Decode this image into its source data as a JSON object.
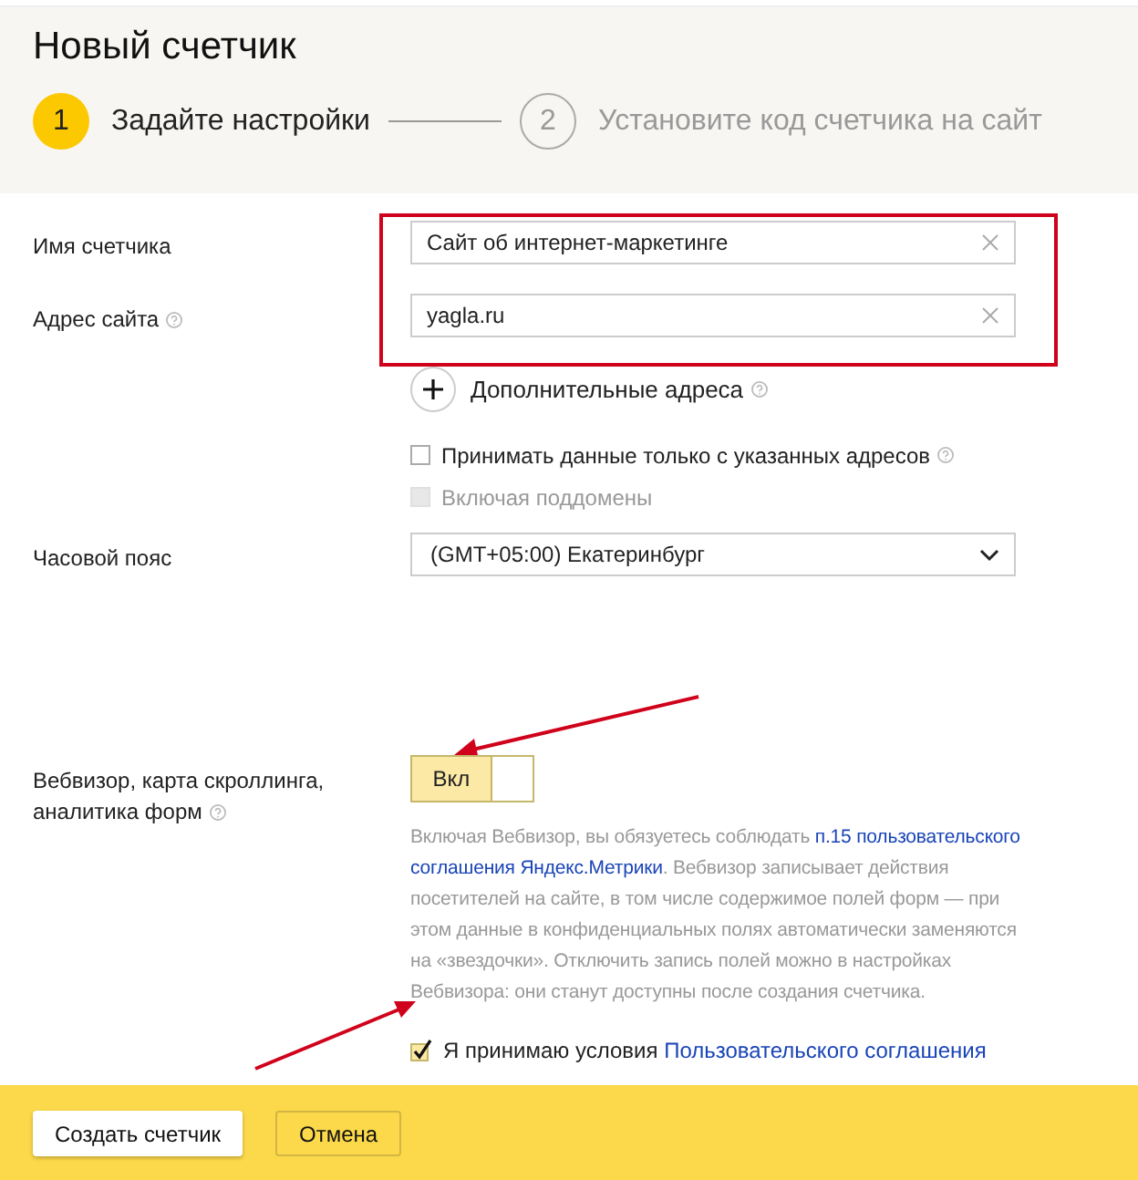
{
  "title": "Новый счетчик",
  "steps": [
    {
      "number": "1",
      "label": "Задайте настройки",
      "selected": true
    },
    {
      "number": "2",
      "label": "Установите код счетчика на сайт",
      "selected": false
    }
  ],
  "fields": {
    "name": {
      "label": "Имя счетчика",
      "value": "Сайт об интернет-маркетинге"
    },
    "address": {
      "label": "Адрес сайта",
      "value": "yagla.ru"
    },
    "extra_addresses": {
      "label": "Дополнительные адреса"
    },
    "options": [
      {
        "label": "Принимать данные только с указанных адресов",
        "checked": false,
        "disabled": false,
        "help": true
      },
      {
        "label": "Включая поддомены",
        "checked": false,
        "disabled": true,
        "help": false
      }
    ],
    "timezone": {
      "label": "Часовой пояс",
      "value": "(GMT+05:00) Екатеринбург"
    },
    "webvisor": {
      "label_lines": [
        "Вебвизор, карта скроллинга,",
        "аналитика форм"
      ],
      "toggle": "Вкл",
      "on": true,
      "note": "Включая Вебвизор, вы обязуетесь соблюдать ",
      "note_link_lines": [
        "п.15 пользовательского",
        "соглашения Яндекс.Метрики"
      ],
      "note_rest": ". Вебвизор записывает действия посетителей на сайте, в том числе содержимое полей форм — при этом данные в конфиденциальных полях автоматически заменяются на «звездочки». Отключить запись полей можно в настройках Вебвизора: они станут доступны после создания счетчика."
    },
    "agreement": {
      "label": "Я принимаю условия ",
      "link": "Пользовательского соглашения",
      "checked": true
    }
  },
  "buttons": [
    {
      "label": "Создать счетчик",
      "kind": "primary"
    },
    {
      "label": "Отмена",
      "kind": "secondary"
    }
  ]
}
